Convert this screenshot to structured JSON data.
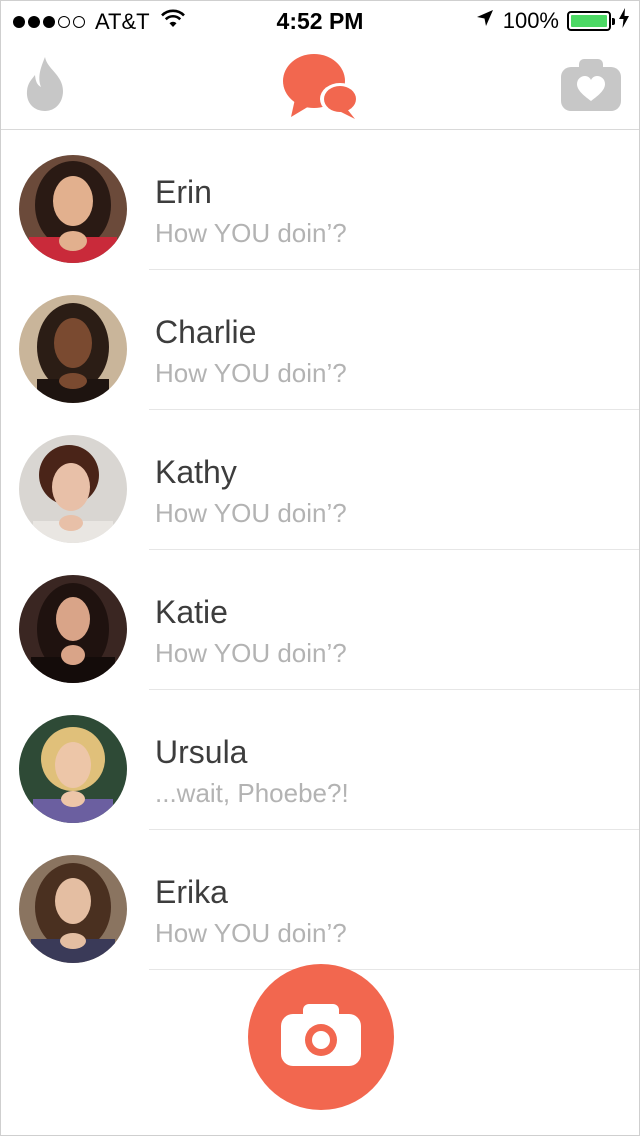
{
  "status_bar": {
    "carrier": "AT&T",
    "time": "4:52 PM",
    "battery_percent": "100%",
    "signal_bars_filled": 3,
    "signal_bars_total": 5,
    "battery_color": "#4cd964"
  },
  "nav": {
    "left_icon": "flame-icon",
    "center_icon": "chat-bubbles-icon",
    "right_icon": "camera-heart-icon",
    "accent_color": "#f2674f",
    "inactive_color": "#c7c7c7"
  },
  "messages": [
    {
      "name": "Erin",
      "preview": "How YOU doin’?"
    },
    {
      "name": "Charlie",
      "preview": "How YOU doin’?"
    },
    {
      "name": "Kathy",
      "preview": "How YOU doin’?"
    },
    {
      "name": "Katie",
      "preview": "How YOU doin’?"
    },
    {
      "name": "Ursula",
      "preview": "...wait, Phoebe?!"
    },
    {
      "name": "Erika",
      "preview": "How YOU doin’?"
    }
  ],
  "fab": {
    "icon": "camera-icon",
    "color": "#f2674f"
  }
}
